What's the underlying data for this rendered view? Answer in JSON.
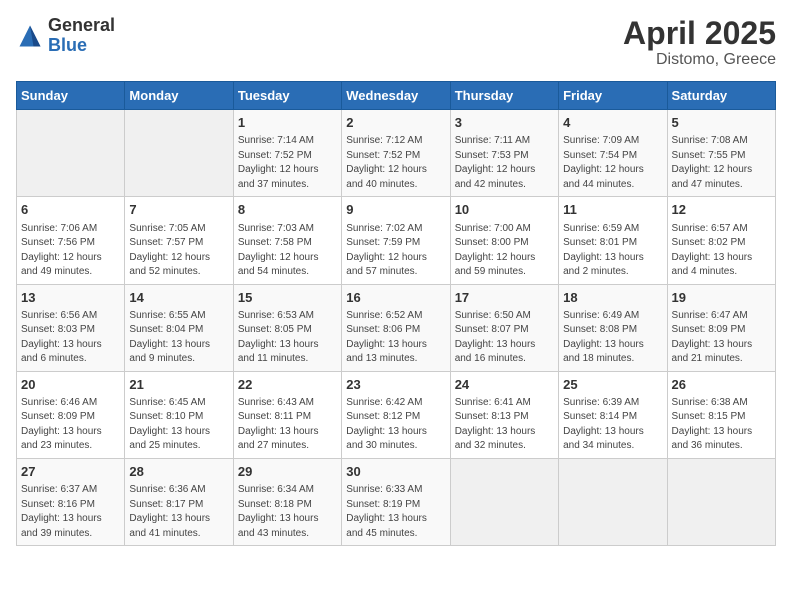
{
  "logo": {
    "general": "General",
    "blue": "Blue"
  },
  "title": "April 2025",
  "subtitle": "Distomo, Greece",
  "days_of_week": [
    "Sunday",
    "Monday",
    "Tuesday",
    "Wednesday",
    "Thursday",
    "Friday",
    "Saturday"
  ],
  "weeks": [
    [
      {
        "num": "",
        "info": ""
      },
      {
        "num": "",
        "info": ""
      },
      {
        "num": "1",
        "info": "Sunrise: 7:14 AM\nSunset: 7:52 PM\nDaylight: 12 hours and 37 minutes."
      },
      {
        "num": "2",
        "info": "Sunrise: 7:12 AM\nSunset: 7:52 PM\nDaylight: 12 hours and 40 minutes."
      },
      {
        "num": "3",
        "info": "Sunrise: 7:11 AM\nSunset: 7:53 PM\nDaylight: 12 hours and 42 minutes."
      },
      {
        "num": "4",
        "info": "Sunrise: 7:09 AM\nSunset: 7:54 PM\nDaylight: 12 hours and 44 minutes."
      },
      {
        "num": "5",
        "info": "Sunrise: 7:08 AM\nSunset: 7:55 PM\nDaylight: 12 hours and 47 minutes."
      }
    ],
    [
      {
        "num": "6",
        "info": "Sunrise: 7:06 AM\nSunset: 7:56 PM\nDaylight: 12 hours and 49 minutes."
      },
      {
        "num": "7",
        "info": "Sunrise: 7:05 AM\nSunset: 7:57 PM\nDaylight: 12 hours and 52 minutes."
      },
      {
        "num": "8",
        "info": "Sunrise: 7:03 AM\nSunset: 7:58 PM\nDaylight: 12 hours and 54 minutes."
      },
      {
        "num": "9",
        "info": "Sunrise: 7:02 AM\nSunset: 7:59 PM\nDaylight: 12 hours and 57 minutes."
      },
      {
        "num": "10",
        "info": "Sunrise: 7:00 AM\nSunset: 8:00 PM\nDaylight: 12 hours and 59 minutes."
      },
      {
        "num": "11",
        "info": "Sunrise: 6:59 AM\nSunset: 8:01 PM\nDaylight: 13 hours and 2 minutes."
      },
      {
        "num": "12",
        "info": "Sunrise: 6:57 AM\nSunset: 8:02 PM\nDaylight: 13 hours and 4 minutes."
      }
    ],
    [
      {
        "num": "13",
        "info": "Sunrise: 6:56 AM\nSunset: 8:03 PM\nDaylight: 13 hours and 6 minutes."
      },
      {
        "num": "14",
        "info": "Sunrise: 6:55 AM\nSunset: 8:04 PM\nDaylight: 13 hours and 9 minutes."
      },
      {
        "num": "15",
        "info": "Sunrise: 6:53 AM\nSunset: 8:05 PM\nDaylight: 13 hours and 11 minutes."
      },
      {
        "num": "16",
        "info": "Sunrise: 6:52 AM\nSunset: 8:06 PM\nDaylight: 13 hours and 13 minutes."
      },
      {
        "num": "17",
        "info": "Sunrise: 6:50 AM\nSunset: 8:07 PM\nDaylight: 13 hours and 16 minutes."
      },
      {
        "num": "18",
        "info": "Sunrise: 6:49 AM\nSunset: 8:08 PM\nDaylight: 13 hours and 18 minutes."
      },
      {
        "num": "19",
        "info": "Sunrise: 6:47 AM\nSunset: 8:09 PM\nDaylight: 13 hours and 21 minutes."
      }
    ],
    [
      {
        "num": "20",
        "info": "Sunrise: 6:46 AM\nSunset: 8:09 PM\nDaylight: 13 hours and 23 minutes."
      },
      {
        "num": "21",
        "info": "Sunrise: 6:45 AM\nSunset: 8:10 PM\nDaylight: 13 hours and 25 minutes."
      },
      {
        "num": "22",
        "info": "Sunrise: 6:43 AM\nSunset: 8:11 PM\nDaylight: 13 hours and 27 minutes."
      },
      {
        "num": "23",
        "info": "Sunrise: 6:42 AM\nSunset: 8:12 PM\nDaylight: 13 hours and 30 minutes."
      },
      {
        "num": "24",
        "info": "Sunrise: 6:41 AM\nSunset: 8:13 PM\nDaylight: 13 hours and 32 minutes."
      },
      {
        "num": "25",
        "info": "Sunrise: 6:39 AM\nSunset: 8:14 PM\nDaylight: 13 hours and 34 minutes."
      },
      {
        "num": "26",
        "info": "Sunrise: 6:38 AM\nSunset: 8:15 PM\nDaylight: 13 hours and 36 minutes."
      }
    ],
    [
      {
        "num": "27",
        "info": "Sunrise: 6:37 AM\nSunset: 8:16 PM\nDaylight: 13 hours and 39 minutes."
      },
      {
        "num": "28",
        "info": "Sunrise: 6:36 AM\nSunset: 8:17 PM\nDaylight: 13 hours and 41 minutes."
      },
      {
        "num": "29",
        "info": "Sunrise: 6:34 AM\nSunset: 8:18 PM\nDaylight: 13 hours and 43 minutes."
      },
      {
        "num": "30",
        "info": "Sunrise: 6:33 AM\nSunset: 8:19 PM\nDaylight: 13 hours and 45 minutes."
      },
      {
        "num": "",
        "info": ""
      },
      {
        "num": "",
        "info": ""
      },
      {
        "num": "",
        "info": ""
      }
    ]
  ]
}
